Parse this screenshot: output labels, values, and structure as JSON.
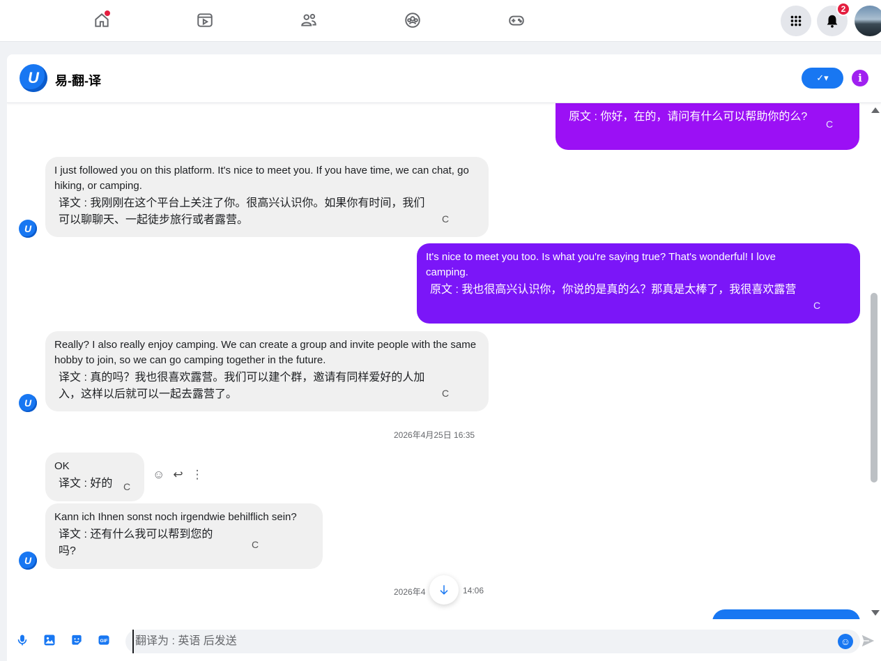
{
  "topnav": {
    "items": [
      "home-icon",
      "video-icon",
      "friends-icon",
      "groups-icon",
      "gaming-icon"
    ],
    "notification_count": "2"
  },
  "chat": {
    "title": "易-翻-译",
    "logo_letter": "U",
    "toggle_label": "✓▾",
    "info_label": "i",
    "accent": "#1877f2",
    "purple": "#a020f0"
  },
  "messages": [
    {
      "direction": "out",
      "original": "",
      "translation": "原文 : 你好，在的，请问有什么可以帮助你的么?"
    },
    {
      "direction": "in",
      "original": "I just followed you on this platform. It's nice to meet you. If you have time, we can chat, go hiking, or camping.",
      "translation": "译文 : 我刚刚在这个平台上关注了你。很高兴认识你。如果你有时间，我们可以聊聊天、一起徒步旅行或者露营。"
    },
    {
      "direction": "out",
      "original": "It's nice to meet you too. Is what you're saying true? That's wonderful! I love camping.",
      "translation": "原文 : 我也很高兴认识你，你说的是真的么？那真是太棒了，我很喜欢露营"
    },
    {
      "direction": "in",
      "original": "Really? I also really enjoy camping. We can create a group and invite people with the same hobby to join, so we can go camping together in the future.",
      "translation": "译文 : 真的吗？我也很喜欢露营。我们可以建个群，邀请有同样爱好的人加入，这样以后就可以一起去露营了。"
    },
    {
      "direction": "in",
      "original": "OK",
      "translation": "译文 : 好的"
    },
    {
      "direction": "in",
      "original": "Kann ich Ihnen sonst noch irgendwie behilflich sein?",
      "translation": "译文 : 还有什么我可以帮到您的吗?"
    }
  ],
  "timestamps": [
    "2026年4月25日 16:35",
    "2026年4",
    "14:06"
  ],
  "refresh_glyph": "C",
  "composer": {
    "placeholder": "翻译为 : 英语 后发送"
  }
}
